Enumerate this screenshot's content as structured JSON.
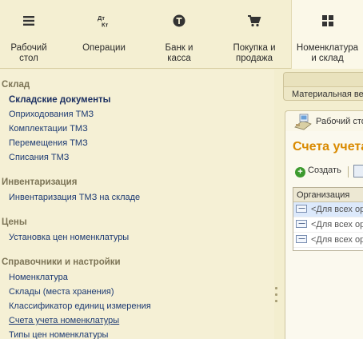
{
  "sections": [
    {
      "label": "Рабочий\nстол",
      "icon": "menu-lines-icon"
    },
    {
      "label": "Операции",
      "icon": "debit-credit-icon"
    },
    {
      "label": "Банк и\nкасса",
      "icon": "coin-icon"
    },
    {
      "label": "Покупка и\nпродажа",
      "icon": "cart-icon"
    },
    {
      "label": "Номенклатура\nи склад",
      "icon": "grid-icon"
    }
  ],
  "nav": {
    "group_sklad": "Склад",
    "item_docs": "Складские документы",
    "item_receipts": "Оприходования ТМЗ",
    "item_kits": "Комплектации ТМЗ",
    "item_moves": "Перемещения ТМЗ",
    "item_writeoffs": "Списания ТМЗ",
    "group_inventory": "Инвентаризация",
    "item_inventory": "Инвентаризация ТМЗ на складе",
    "group_prices": "Цены",
    "item_prices": "Установка цен номенклатуры",
    "group_refs": "Справочники и настройки",
    "item_nomenclature": "Номенклатура",
    "item_warehouses": "Склады (места хранения)",
    "item_units": "Классификатор единиц измерения",
    "item_accounts": "Счета учета номенклатуры",
    "item_price_types": "Типы цен номенклатуры"
  },
  "workspace": {
    "top_tab": "Материальная ведомость",
    "page_tab": "Рабочий стол",
    "title": "Счета учета номенклатуры",
    "create_label": "Создать",
    "grid_header": "Организация",
    "rows": [
      "<Для всех организаций>",
      "<Для всех организаций>",
      "<Для всех организаций>"
    ]
  }
}
